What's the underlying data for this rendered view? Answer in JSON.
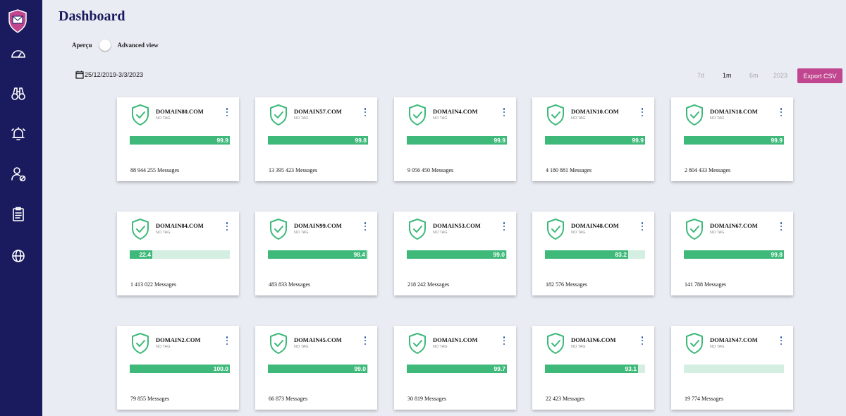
{
  "header": {
    "title": "Dashboard"
  },
  "view_toggle": {
    "left_label": "Aperçu",
    "right_label": "Advanced view"
  },
  "date_range": "25/12/2019-3/3/2023",
  "periods": [
    {
      "label": "7d",
      "active": false
    },
    {
      "label": "1m",
      "active": true
    },
    {
      "label": "6m",
      "active": false
    },
    {
      "label": "2023",
      "active": false
    }
  ],
  "export_label": "Export CSV",
  "sidebar": {
    "logo": "envelope-shield-logo",
    "items": [
      "dashboard-gauge-icon",
      "binoculars-icon",
      "alarm-bell-icon",
      "user-blocked-icon",
      "clipboard-icon",
      "globe-icon"
    ]
  },
  "colors": {
    "sidebar": "#1a1a5e",
    "accent": "#c0478f",
    "success": "#3eb97a",
    "track": "#d4efe1",
    "menu_dots": "#2a5aa6"
  },
  "domains": [
    {
      "name": "DOMAIN80.COM",
      "tag": "NO TAG",
      "score": 99.9,
      "score_label": "99.9",
      "messages": "88 944 255 Messages"
    },
    {
      "name": "DOMAIN57.COM",
      "tag": "NO TAG",
      "score": 99.8,
      "score_label": "99.8",
      "messages": "13 395 423 Messages"
    },
    {
      "name": "DOMAIN4.COM",
      "tag": "NO TAG",
      "score": 99.9,
      "score_label": "99.9",
      "messages": "9 056 450 Messages"
    },
    {
      "name": "DOMAIN10.COM",
      "tag": "NO TAG",
      "score": 99.9,
      "score_label": "99.9",
      "messages": "4 180 881 Messages"
    },
    {
      "name": "DOMAIN18.COM",
      "tag": "NO TAG",
      "score": 99.9,
      "score_label": "99.9",
      "messages": "2 804 433 Messages"
    },
    {
      "name": "DOMAIN84.COM",
      "tag": "NO TAG",
      "score": 22.4,
      "score_label": "22.4",
      "messages": "1 413 022 Messages"
    },
    {
      "name": "DOMAIN99.COM",
      "tag": "NO TAG",
      "score": 98.4,
      "score_label": "98.4",
      "messages": "483 833 Messages"
    },
    {
      "name": "DOMAIN53.COM",
      "tag": "NO TAG",
      "score": 99.0,
      "score_label": "99.0",
      "messages": "218 242 Messages"
    },
    {
      "name": "DOMAIN48.COM",
      "tag": "NO TAG",
      "score": 83.2,
      "score_label": "83.2",
      "messages": "182 576 Messages"
    },
    {
      "name": "DOMAIN67.COM",
      "tag": "NO TAG",
      "score": 99.8,
      "score_label": "99.8",
      "messages": "141 788 Messages"
    },
    {
      "name": "DOMAIN2.COM",
      "tag": "NO TAG",
      "score": 100.0,
      "score_label": "100.0",
      "messages": "79 855 Messages"
    },
    {
      "name": "DOMAIN45.COM",
      "tag": "NO TAG",
      "score": 99.0,
      "score_label": "99.0",
      "messages": "66 873 Messages"
    },
    {
      "name": "DOMAIN1.COM",
      "tag": "NO TAG",
      "score": 99.7,
      "score_label": "99.7",
      "messages": "30 819 Messages"
    },
    {
      "name": "DOMAIN6.COM",
      "tag": "NO TAG",
      "score": 93.1,
      "score_label": "93.1",
      "messages": "22 423 Messages"
    },
    {
      "name": "DOMAIN47.COM",
      "tag": "NO TAG",
      "score": 0,
      "score_label": "",
      "messages": "19 774 Messages"
    }
  ]
}
